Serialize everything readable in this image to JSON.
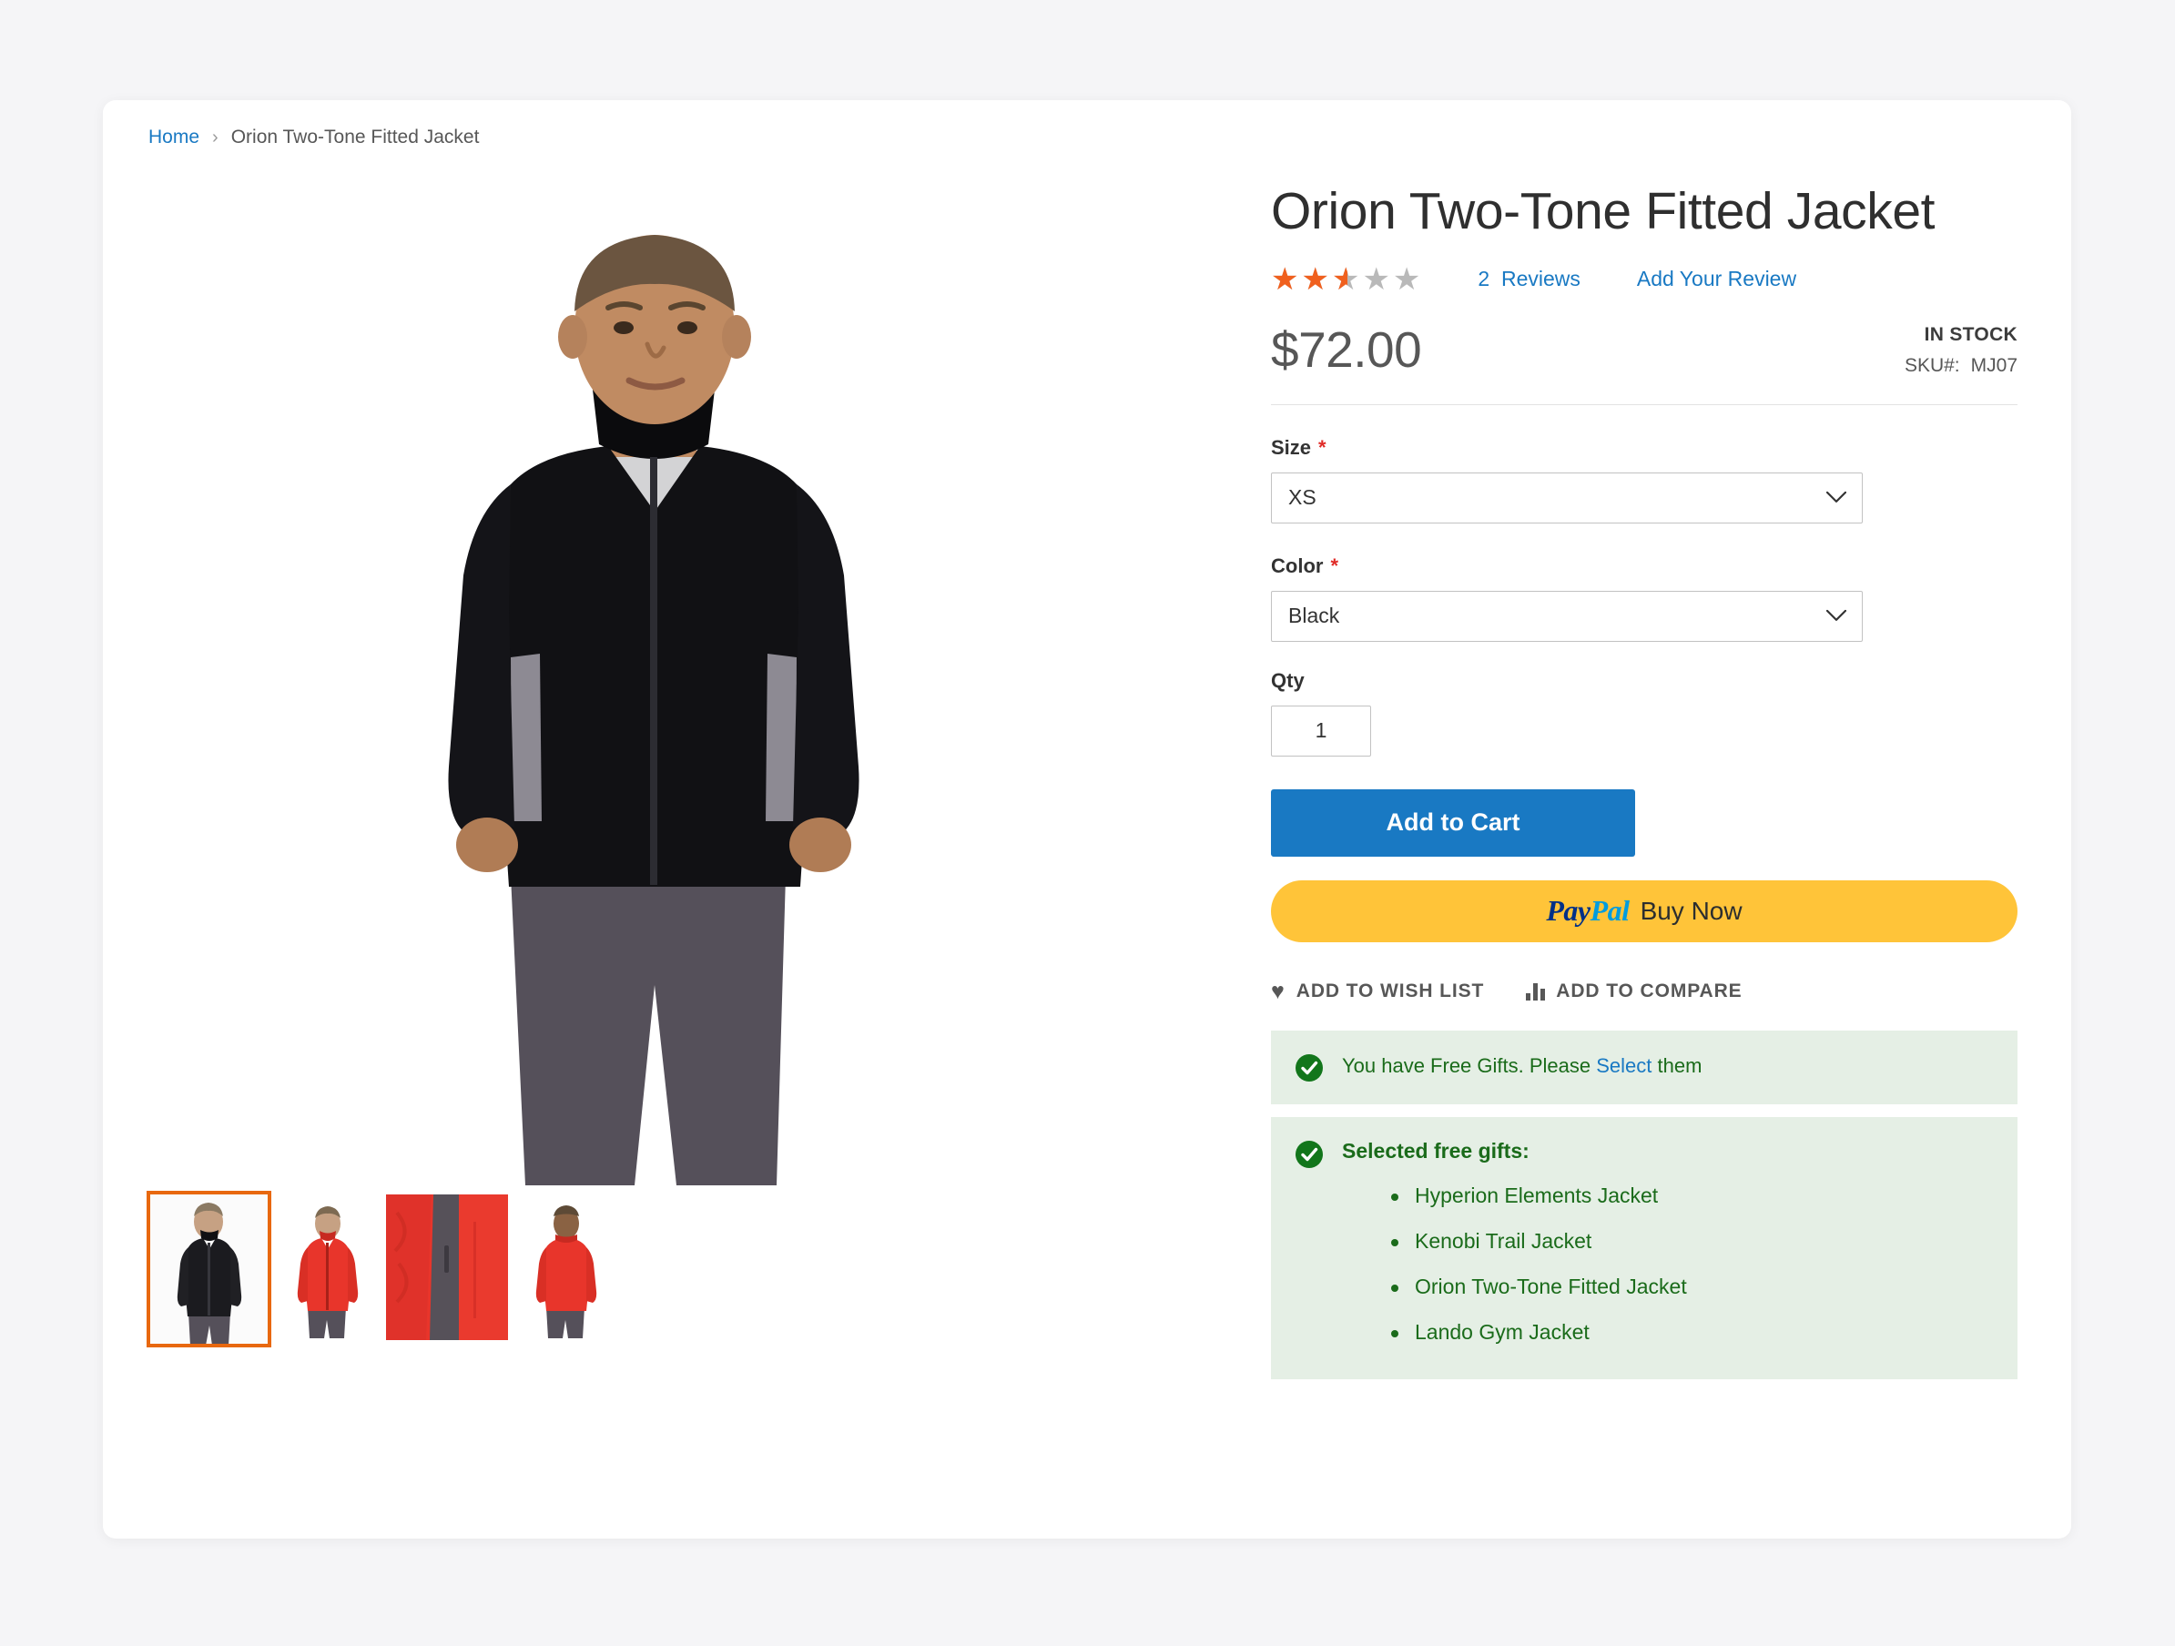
{
  "breadcrumb": {
    "home_label": "Home",
    "separator": "›",
    "current_label": "Orion Two-Tone Fitted Jacket"
  },
  "product": {
    "title": "Orion Two-Tone Fitted Jacket",
    "rating_value": 2.5,
    "rating_max": 5,
    "rating_percent": "50%",
    "reviews_count_label": "2",
    "reviews_label": "Reviews",
    "add_review_label": "Add Your Review",
    "price": "$72.00",
    "stock_status": "IN STOCK",
    "sku_label": "SKU#:",
    "sku_value": "MJ07"
  },
  "options": {
    "size": {
      "label": "Size",
      "required_mark": "*",
      "selected": "XS"
    },
    "color": {
      "label": "Color",
      "required_mark": "*",
      "selected": "Black"
    },
    "qty": {
      "label": "Qty",
      "value": "1"
    }
  },
  "actions": {
    "add_to_cart_label": "Add to Cart",
    "paypal_pay": "Pay",
    "paypal_pal": "Pal",
    "paypal_buynow_label": "Buy Now",
    "wishlist_label": "ADD TO WISH LIST",
    "compare_label": "ADD TO COMPARE"
  },
  "messages": {
    "free_gift_prefix": "You have Free Gifts. Please ",
    "free_gift_link": "Select",
    "free_gift_suffix": " them",
    "selected_gifts_title": "Selected free gifts:",
    "selected_gifts": [
      "Hyperion Elements Jacket",
      "Kenobi Trail Jacket",
      "Orion Two-Tone Fitted Jacket",
      "Lando Gym Jacket"
    ]
  },
  "gallery": {
    "main_alt": "Model wearing black Orion Two-Tone Fitted Jacket",
    "thumbnails": [
      {
        "name": "thumb-black-front",
        "selected": true
      },
      {
        "name": "thumb-red-front",
        "selected": false
      },
      {
        "name": "thumb-red-zipper-detail",
        "selected": false
      },
      {
        "name": "thumb-red-back",
        "selected": false
      }
    ]
  },
  "colors": {
    "accent_blue": "#1979c3",
    "star_orange": "#f0601e",
    "paypal_yellow": "#ffc439",
    "success_green": "#1a6b1a",
    "success_bg": "#e5efe5",
    "thumb_selected_border": "#e8680f"
  }
}
